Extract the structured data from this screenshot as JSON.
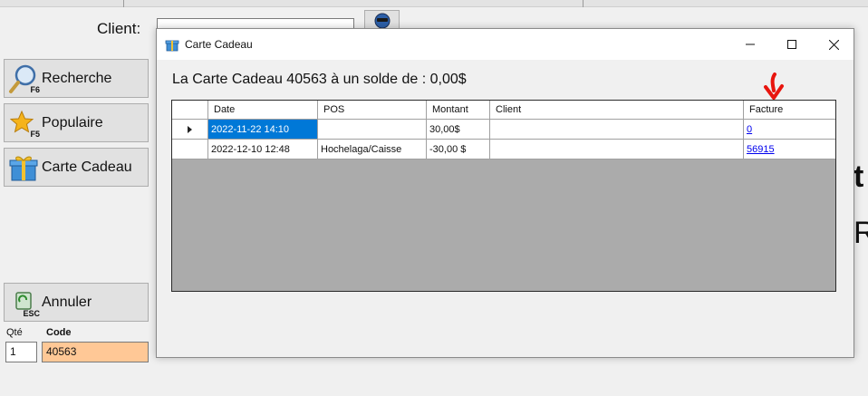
{
  "client": {
    "label": "Client:",
    "value": ""
  },
  "sidebar": {
    "buttons": [
      {
        "label": "Recherche",
        "key": "F6"
      },
      {
        "label": "Populaire",
        "key": "F5"
      },
      {
        "label": "Carte Cadeau"
      },
      {
        "label": "Annuler",
        "key": "ESC"
      }
    ]
  },
  "entry": {
    "qty_label": "Qté",
    "code_label": "Code",
    "qty_value": "1",
    "code_value": "40563"
  },
  "background": {
    "text_1": "t",
    "text_2": "R"
  },
  "dialog": {
    "title": "Carte Cadeau",
    "balance_text": "La Carte Cadeau 40563 à un solde de : 0,00$",
    "columns": [
      "Date",
      "POS",
      "Montant",
      "Client",
      "Facture"
    ],
    "rows": [
      {
        "date": "2022-11-22 14:10",
        "pos": "",
        "montant": "30,00$",
        "client": "",
        "facture": "0"
      },
      {
        "date": "2022-12-10 12:48",
        "pos": "Hochelaga/Caisse",
        "montant": "-30,00 $",
        "client": "",
        "facture": "56915"
      }
    ]
  },
  "colors": {
    "selection": "#0078d7",
    "code_field": "#ffc896",
    "annotation_arrow": "#e8150e",
    "grid_empty": "#ababab"
  }
}
